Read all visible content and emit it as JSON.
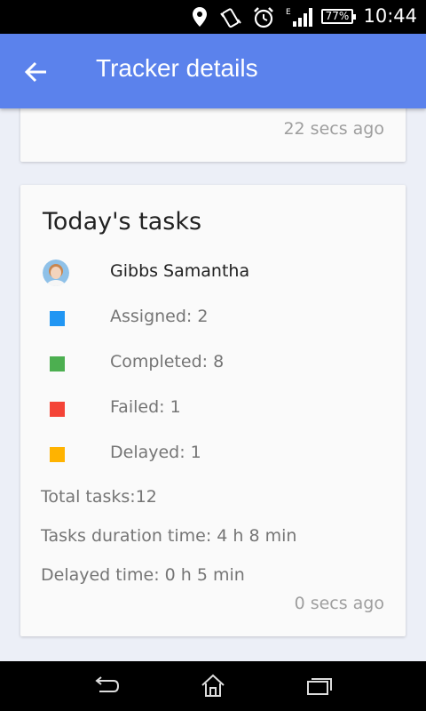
{
  "status_bar": {
    "battery": "77%",
    "time": "10:44",
    "icons": [
      "location-icon",
      "vibrate-icon",
      "alarm-icon",
      "signal-icon",
      "battery-icon"
    ]
  },
  "app_bar": {
    "title": "Tracker details",
    "back_icon": "arrow-back-icon"
  },
  "top_card": {
    "time_ago": "22 secs ago"
  },
  "tasks_card": {
    "title": "Today's tasks",
    "user_name": "Gibbs Samantha",
    "legend": [
      {
        "label": "Assigned: 2",
        "color": "#2196f3"
      },
      {
        "label": "Completed: 8",
        "color": "#4caf50"
      },
      {
        "label": "Failed: 1",
        "color": "#f44336"
      },
      {
        "label": "Delayed: 1",
        "color": "#ffb300"
      }
    ],
    "total_tasks": "Total tasks:12",
    "duration": "Tasks duration time: 4 h 8 min",
    "delayed_time": "Delayed time: 0 h 5 min",
    "time_ago": "0 secs ago"
  },
  "nav_bar": {
    "buttons": [
      "back-icon",
      "home-icon",
      "recent-apps-icon"
    ]
  }
}
